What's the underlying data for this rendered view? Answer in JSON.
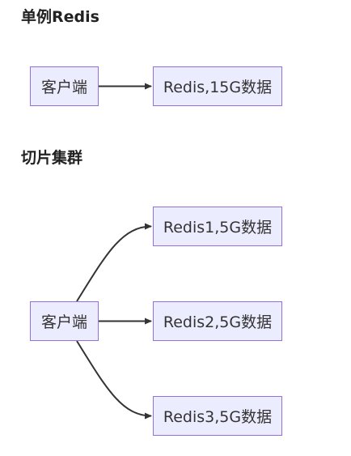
{
  "sections": {
    "single": {
      "title": "单例Redis",
      "client_label": "客户端",
      "server_label": "Redis,15G数据"
    },
    "cluster": {
      "title": "切片集群",
      "client_label": "客户端",
      "shards": [
        {
          "label": "Redis1,5G数据"
        },
        {
          "label": "Redis2,5G数据"
        },
        {
          "label": "Redis3,5G数据"
        }
      ]
    }
  },
  "colors": {
    "node_fill": "#ECECFF",
    "node_border": "#9370DB",
    "edge": "#333333",
    "text": "#333333"
  }
}
